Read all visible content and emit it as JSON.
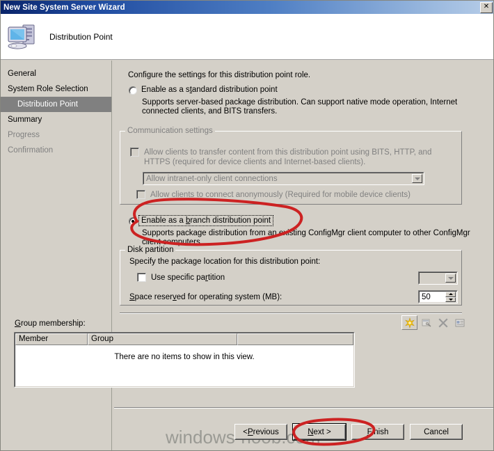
{
  "window": {
    "title": "New Site System Server Wizard",
    "close_label": "✕",
    "icon": "computer-icon"
  },
  "header": {
    "title": "Distribution Point"
  },
  "sidebar": {
    "items": [
      {
        "label": "General",
        "state": "normal"
      },
      {
        "label": "System Role Selection",
        "state": "normal"
      },
      {
        "label": "Distribution Point",
        "state": "active"
      },
      {
        "label": "Summary",
        "state": "normal"
      },
      {
        "label": "Progress",
        "state": "disabled"
      },
      {
        "label": "Confirmation",
        "state": "disabled"
      }
    ]
  },
  "main": {
    "intro": "Configure the settings for this distribution point role.",
    "standard_option": {
      "label": "Enable as a standard distribution point",
      "description": "Supports server-based package distribution. Can support native mode operation, Internet connected clients, and BITS transfers.",
      "checked": false
    },
    "communication_settings": {
      "title": "Communication settings",
      "bits_checkbox": {
        "label": "Allow clients to transfer content from this distribution point using BITS, HTTP, and HTTPS (required for device clients and Internet-based clients).",
        "checked": false,
        "enabled": false
      },
      "connection_combo": {
        "value": "Allow intranet-only client connections",
        "enabled": false
      },
      "anonymous_checkbox": {
        "label": "Allow clients to connect anonymously  (Required for mobile device clients)",
        "checked": false,
        "enabled": false
      }
    },
    "branch_option": {
      "label": "Enable as a branch distribution point",
      "description": "Supports package distribution from an existing ConfigMgr client computer to other ConfigMgr client computers.",
      "checked": true,
      "focused": true
    },
    "disk_partition": {
      "title": "Disk partition",
      "instruction": "Specify the package location for this distribution point:",
      "use_specific_partition": {
        "label": "Use specific partition",
        "checked": false
      },
      "partition_combo": {
        "value": "",
        "enabled": false
      },
      "space_reserved": {
        "label": "Space reserved for operating system (MB):",
        "value": "50"
      }
    },
    "group_membership": {
      "label": "Group membership:",
      "toolbar": [
        {
          "name": "new-icon",
          "enabled": true
        },
        {
          "name": "properties-icon",
          "enabled": false
        },
        {
          "name": "delete-icon",
          "enabled": false
        },
        {
          "name": "details-icon",
          "enabled": false
        }
      ],
      "columns": [
        "Member",
        "Group",
        ""
      ],
      "empty_message": "There are no items to show in this view.",
      "rows": []
    }
  },
  "footer": {
    "buttons": [
      {
        "label": "< Previous",
        "default": false
      },
      {
        "label": "Next >",
        "default": true
      },
      {
        "label": "Finish",
        "default": false
      },
      {
        "label": "Cancel",
        "default": false
      }
    ]
  },
  "watermark": {
    "text": "windows-noob.com"
  },
  "annotations": {
    "color": "#cc2222",
    "shapes": [
      "ellipse-around-branch-option",
      "ellipse-around-next-button"
    ]
  },
  "colors": {
    "titlebar_start": "#0a246a",
    "titlebar_end": "#b7cde8",
    "dialog_face": "#d4d0c8",
    "selection": "#808080",
    "annotation_red": "#cc2222"
  }
}
